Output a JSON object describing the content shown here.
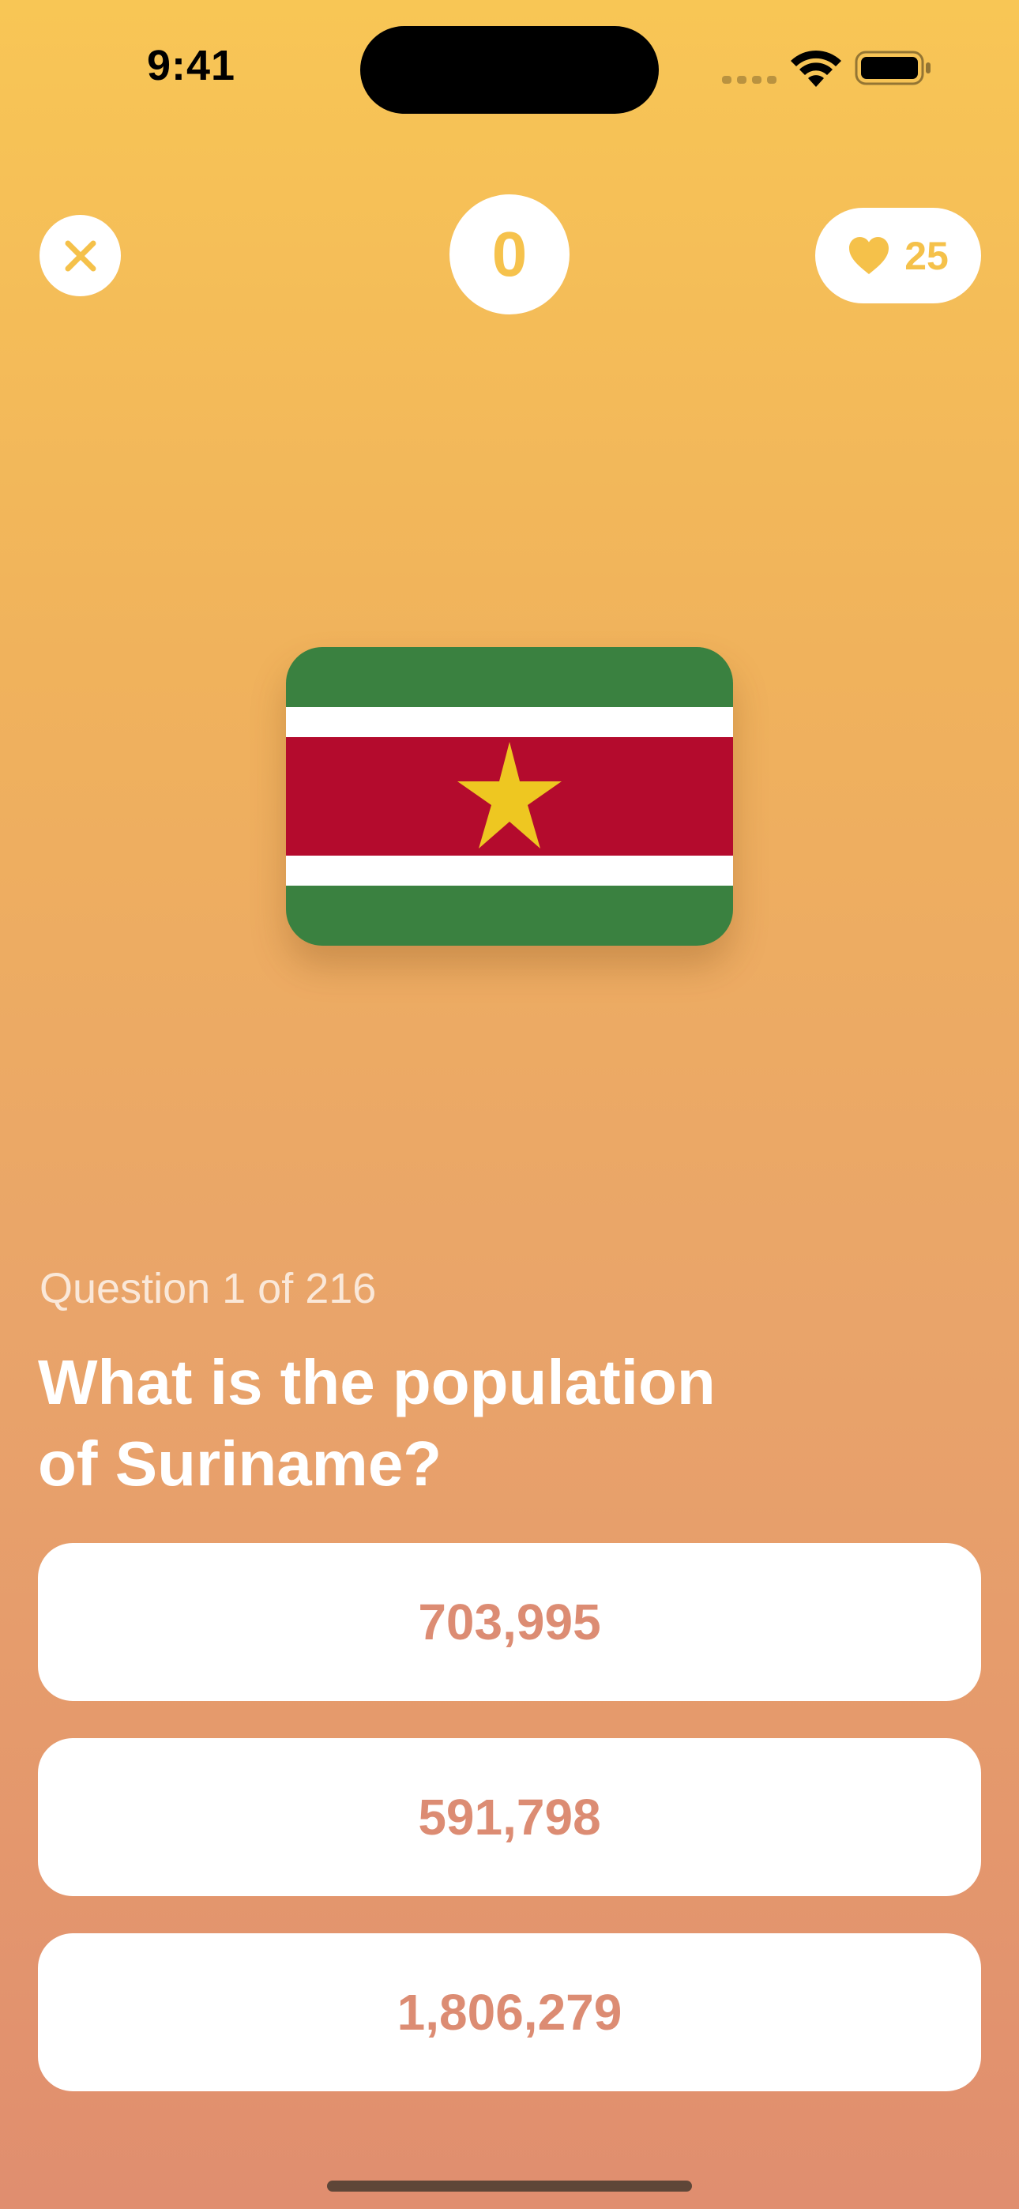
{
  "status_bar": {
    "time": "9:41"
  },
  "header": {
    "score": "0",
    "lives": "25"
  },
  "icons": {
    "close": "close-icon",
    "lives": "heart-icon",
    "wifi": "wifi-icon",
    "battery": "battery-icon",
    "signal": "signal-icon"
  },
  "flag": {
    "country": "Suriname",
    "colors": {
      "green": "#3A8140",
      "white": "#FFFFFF",
      "red": "#B40B2D",
      "star": "#EEC721"
    }
  },
  "question": {
    "counter": "Question 1 of 216",
    "text": "What is the population of Suriname?"
  },
  "answers": [
    {
      "label": "703,995"
    },
    {
      "label": "591,798"
    },
    {
      "label": "1,806,279"
    }
  ],
  "theme": {
    "accent": "#F6C24C",
    "answer_text": "#DC8C73",
    "gradient_top": "#F8C655",
    "gradient_bottom": "#E08E6F"
  }
}
